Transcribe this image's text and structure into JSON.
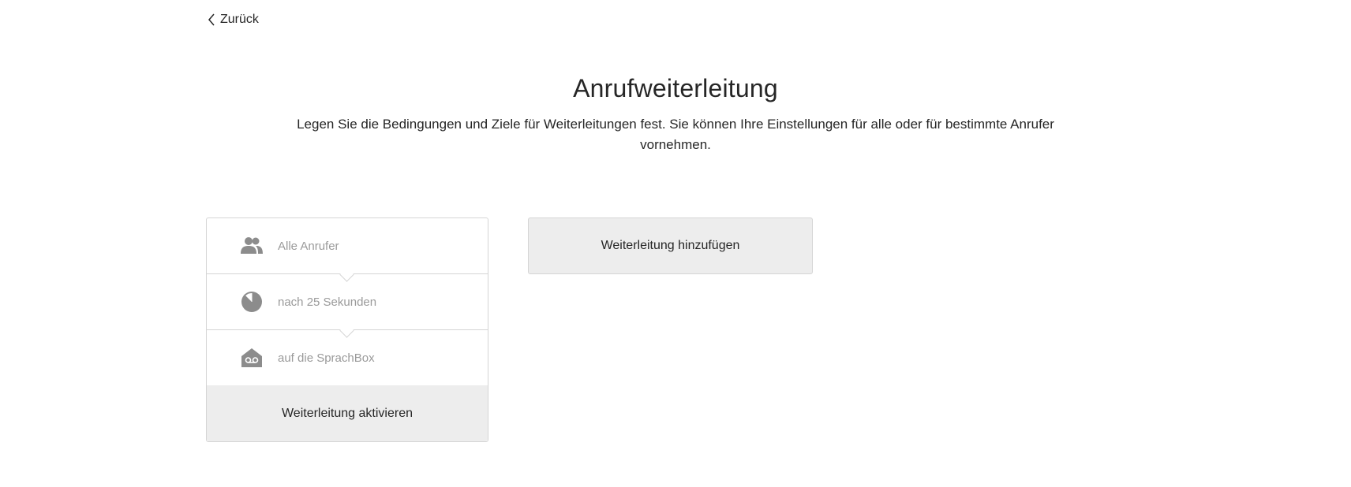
{
  "nav": {
    "back_label": "Zurück",
    "back_icon": "chevron-left-icon"
  },
  "header": {
    "title": "Anrufweiterleitung",
    "description": "Legen Sie die Bedingungen und Ziele für Weiterleitungen fest. Sie können Ihre Einstellungen für alle oder für bestimmte Anrufer vornehmen."
  },
  "rule": {
    "rows": [
      {
        "icon": "users-icon",
        "label": "Alle Anrufer"
      },
      {
        "icon": "clock-icon",
        "label": "nach 25 Sekunden"
      },
      {
        "icon": "voicemail-box-icon",
        "label": "auf die SprachBox"
      }
    ],
    "activate_label": "Weiterleitung aktivieren"
  },
  "actions": {
    "add_label": "Weiterleitung hinzufügen"
  },
  "colors": {
    "text": "#262626",
    "muted": "#9a9a9a",
    "icon": "#8c8c8c",
    "border": "#d5d5d5",
    "button_bg": "#ededed"
  }
}
